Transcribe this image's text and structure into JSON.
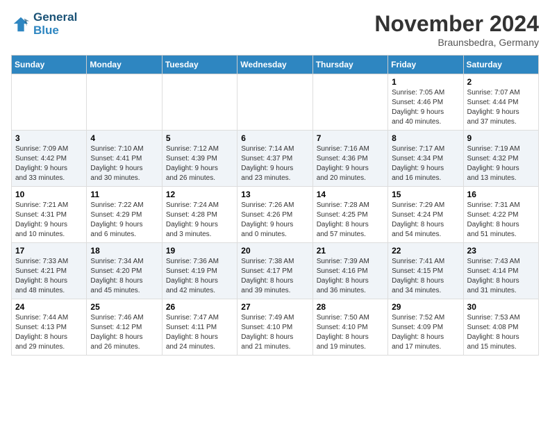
{
  "header": {
    "logo_line1": "General",
    "logo_line2": "Blue",
    "month_title": "November 2024",
    "location": "Braunsbedra, Germany"
  },
  "weekdays": [
    "Sunday",
    "Monday",
    "Tuesday",
    "Wednesday",
    "Thursday",
    "Friday",
    "Saturday"
  ],
  "weeks": [
    [
      {
        "day": "",
        "info": ""
      },
      {
        "day": "",
        "info": ""
      },
      {
        "day": "",
        "info": ""
      },
      {
        "day": "",
        "info": ""
      },
      {
        "day": "",
        "info": ""
      },
      {
        "day": "1",
        "info": "Sunrise: 7:05 AM\nSunset: 4:46 PM\nDaylight: 9 hours\nand 40 minutes."
      },
      {
        "day": "2",
        "info": "Sunrise: 7:07 AM\nSunset: 4:44 PM\nDaylight: 9 hours\nand 37 minutes."
      }
    ],
    [
      {
        "day": "3",
        "info": "Sunrise: 7:09 AM\nSunset: 4:42 PM\nDaylight: 9 hours\nand 33 minutes."
      },
      {
        "day": "4",
        "info": "Sunrise: 7:10 AM\nSunset: 4:41 PM\nDaylight: 9 hours\nand 30 minutes."
      },
      {
        "day": "5",
        "info": "Sunrise: 7:12 AM\nSunset: 4:39 PM\nDaylight: 9 hours\nand 26 minutes."
      },
      {
        "day": "6",
        "info": "Sunrise: 7:14 AM\nSunset: 4:37 PM\nDaylight: 9 hours\nand 23 minutes."
      },
      {
        "day": "7",
        "info": "Sunrise: 7:16 AM\nSunset: 4:36 PM\nDaylight: 9 hours\nand 20 minutes."
      },
      {
        "day": "8",
        "info": "Sunrise: 7:17 AM\nSunset: 4:34 PM\nDaylight: 9 hours\nand 16 minutes."
      },
      {
        "day": "9",
        "info": "Sunrise: 7:19 AM\nSunset: 4:32 PM\nDaylight: 9 hours\nand 13 minutes."
      }
    ],
    [
      {
        "day": "10",
        "info": "Sunrise: 7:21 AM\nSunset: 4:31 PM\nDaylight: 9 hours\nand 10 minutes."
      },
      {
        "day": "11",
        "info": "Sunrise: 7:22 AM\nSunset: 4:29 PM\nDaylight: 9 hours\nand 6 minutes."
      },
      {
        "day": "12",
        "info": "Sunrise: 7:24 AM\nSunset: 4:28 PM\nDaylight: 9 hours\nand 3 minutes."
      },
      {
        "day": "13",
        "info": "Sunrise: 7:26 AM\nSunset: 4:26 PM\nDaylight: 9 hours\nand 0 minutes."
      },
      {
        "day": "14",
        "info": "Sunrise: 7:28 AM\nSunset: 4:25 PM\nDaylight: 8 hours\nand 57 minutes."
      },
      {
        "day": "15",
        "info": "Sunrise: 7:29 AM\nSunset: 4:24 PM\nDaylight: 8 hours\nand 54 minutes."
      },
      {
        "day": "16",
        "info": "Sunrise: 7:31 AM\nSunset: 4:22 PM\nDaylight: 8 hours\nand 51 minutes."
      }
    ],
    [
      {
        "day": "17",
        "info": "Sunrise: 7:33 AM\nSunset: 4:21 PM\nDaylight: 8 hours\nand 48 minutes."
      },
      {
        "day": "18",
        "info": "Sunrise: 7:34 AM\nSunset: 4:20 PM\nDaylight: 8 hours\nand 45 minutes."
      },
      {
        "day": "19",
        "info": "Sunrise: 7:36 AM\nSunset: 4:19 PM\nDaylight: 8 hours\nand 42 minutes."
      },
      {
        "day": "20",
        "info": "Sunrise: 7:38 AM\nSunset: 4:17 PM\nDaylight: 8 hours\nand 39 minutes."
      },
      {
        "day": "21",
        "info": "Sunrise: 7:39 AM\nSunset: 4:16 PM\nDaylight: 8 hours\nand 36 minutes."
      },
      {
        "day": "22",
        "info": "Sunrise: 7:41 AM\nSunset: 4:15 PM\nDaylight: 8 hours\nand 34 minutes."
      },
      {
        "day": "23",
        "info": "Sunrise: 7:43 AM\nSunset: 4:14 PM\nDaylight: 8 hours\nand 31 minutes."
      }
    ],
    [
      {
        "day": "24",
        "info": "Sunrise: 7:44 AM\nSunset: 4:13 PM\nDaylight: 8 hours\nand 29 minutes."
      },
      {
        "day": "25",
        "info": "Sunrise: 7:46 AM\nSunset: 4:12 PM\nDaylight: 8 hours\nand 26 minutes."
      },
      {
        "day": "26",
        "info": "Sunrise: 7:47 AM\nSunset: 4:11 PM\nDaylight: 8 hours\nand 24 minutes."
      },
      {
        "day": "27",
        "info": "Sunrise: 7:49 AM\nSunset: 4:10 PM\nDaylight: 8 hours\nand 21 minutes."
      },
      {
        "day": "28",
        "info": "Sunrise: 7:50 AM\nSunset: 4:10 PM\nDaylight: 8 hours\nand 19 minutes."
      },
      {
        "day": "29",
        "info": "Sunrise: 7:52 AM\nSunset: 4:09 PM\nDaylight: 8 hours\nand 17 minutes."
      },
      {
        "day": "30",
        "info": "Sunrise: 7:53 AM\nSunset: 4:08 PM\nDaylight: 8 hours\nand 15 minutes."
      }
    ]
  ]
}
